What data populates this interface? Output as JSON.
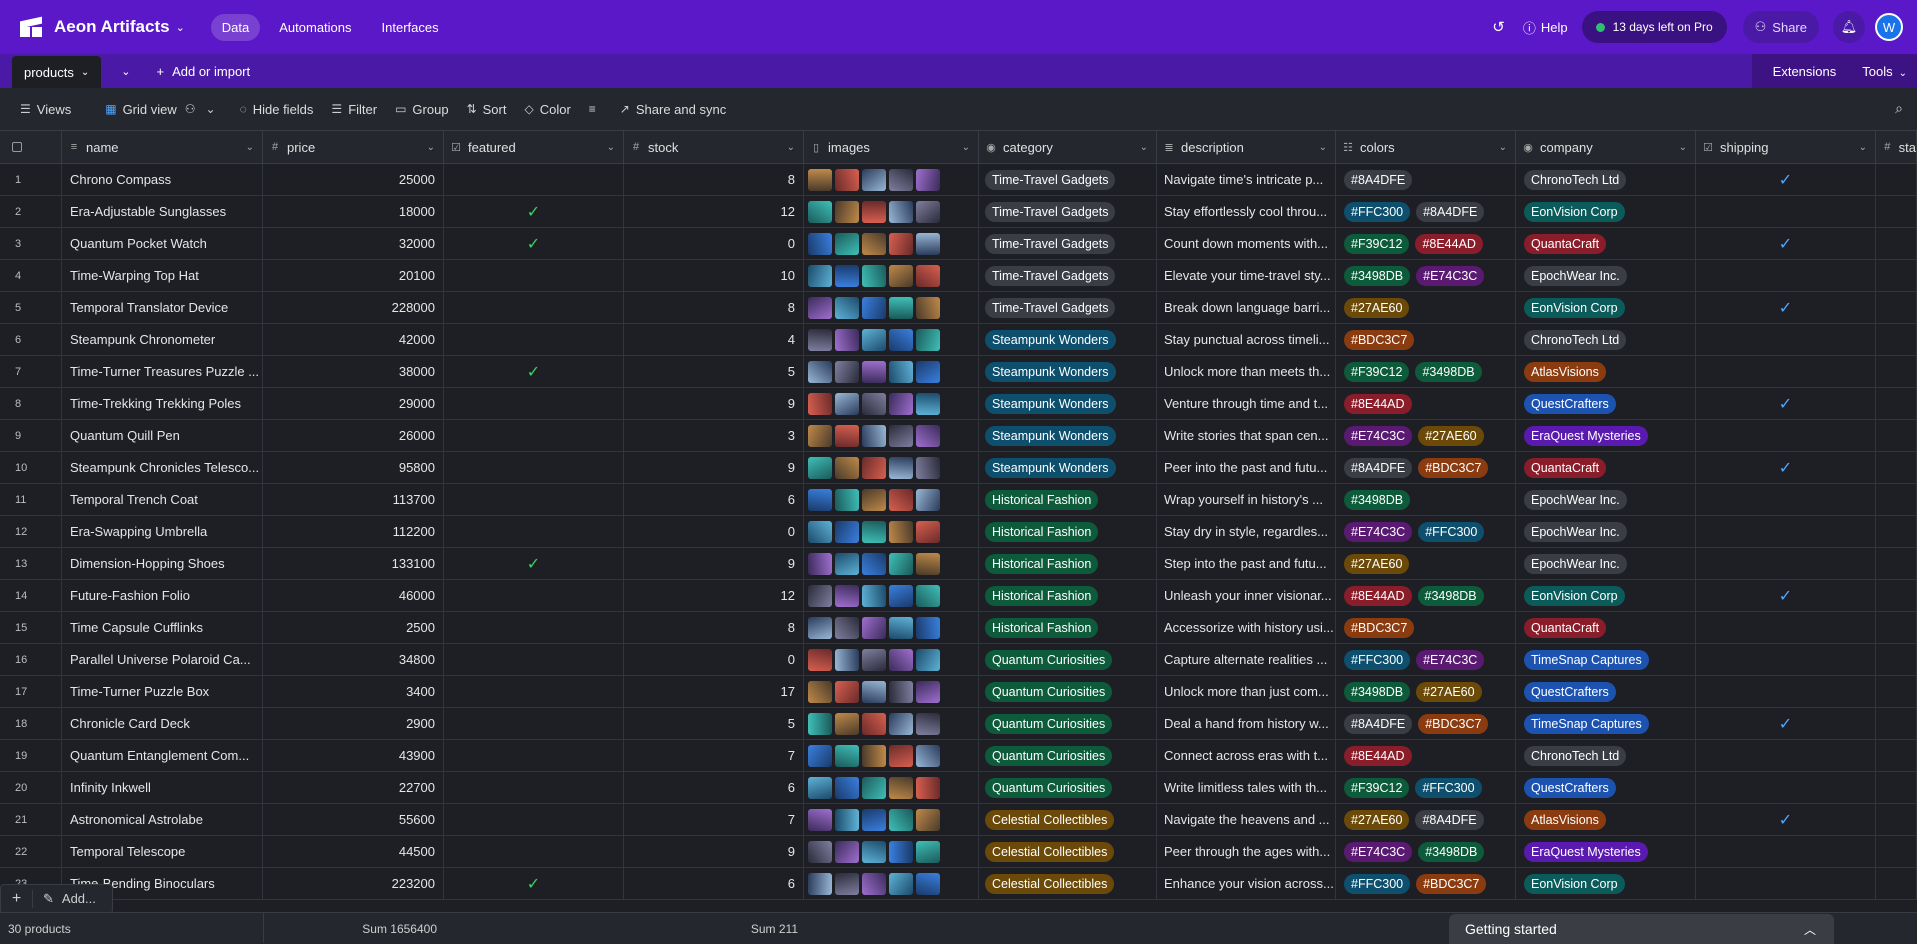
{
  "header": {
    "app_name": "Aeon Artifacts",
    "nav": [
      {
        "label": "Data",
        "active": true
      },
      {
        "label": "Automations"
      },
      {
        "label": "Interfaces"
      }
    ],
    "help": "Help",
    "trial": "13 days left on Pro",
    "share": "Share",
    "avatar": "W"
  },
  "tabbar": {
    "table": "products",
    "add": "Add or import",
    "extensions": "Extensions",
    "tools": "Tools"
  },
  "toolbar": {
    "views": "Views",
    "grid_view": "Grid view",
    "hide_fields": "Hide fields",
    "filter": "Filter",
    "group": "Group",
    "sort": "Sort",
    "color": "Color",
    "share_sync": "Share and sync"
  },
  "columns": [
    {
      "label": "name",
      "icon": "text-icon"
    },
    {
      "label": "price",
      "icon": "number-icon"
    },
    {
      "label": "featured",
      "icon": "checkbox-icon"
    },
    {
      "label": "stock",
      "icon": "number-icon"
    },
    {
      "label": "images",
      "icon": "attachment-icon"
    },
    {
      "label": "category",
      "icon": "select-icon"
    },
    {
      "label": "description",
      "icon": "longtext-icon"
    },
    {
      "label": "colors",
      "icon": "multiselect-icon"
    },
    {
      "label": "company",
      "icon": "select-icon"
    },
    {
      "label": "shipping",
      "icon": "checkbox-icon"
    },
    {
      "label": "sta",
      "icon": "number-icon"
    }
  ],
  "colors": {
    "Time-Travel Gadgets": "#3b3d44",
    "Steampunk Wonders": "#0e4f6e",
    "Historical Fashion": "#0d5b3b",
    "Quantum Curiosities": "#0d5b3b",
    "Celestial Collectibles": "#6b4a09",
    "ChronoTech Ltd": "#3b3d44",
    "EonVision Corp": "#0b5b5b",
    "QuantaCraft": "#8a1d2a",
    "EpochWear Inc.": "#3b3d44",
    "AtlasVisions": "#8a3b0f",
    "QuestCrafters": "#1c52b0",
    "EraQuest Mysteries": "#5a1ab0",
    "TimeSnap Captures": "#1c52b0",
    "#8A4DFE": "#3b3d44",
    "#FFC300": "#0e4f6e",
    "#F39C12": "#0d5b3b",
    "#8E44AD": "#8a1d2a",
    "#3498DB": "#0d5b3b",
    "#E74C3C": "#5a1a72",
    "#27AE60": "#6b4a09",
    "#BDC3C7": "#8a3b0f"
  },
  "rows": [
    {
      "n": "1",
      "name": "Chrono Compass",
      "price": "25000",
      "featured": false,
      "stock": "8",
      "category": "Time-Travel Gadgets",
      "description": "Navigate time's intricate p...",
      "colors": [
        "#8A4DFE"
      ],
      "company": "ChronoTech Ltd",
      "shipping": true
    },
    {
      "n": "2",
      "name": "Era-Adjustable Sunglasses",
      "price": "18000",
      "featured": true,
      "stock": "12",
      "category": "Time-Travel Gadgets",
      "description": "Stay effortlessly cool throu...",
      "colors": [
        "#FFC300",
        "#8A4DFE"
      ],
      "company": "EonVision Corp",
      "shipping": false
    },
    {
      "n": "3",
      "name": "Quantum Pocket Watch",
      "price": "32000",
      "featured": true,
      "stock": "0",
      "category": "Time-Travel Gadgets",
      "description": "Count down moments with...",
      "colors": [
        "#F39C12",
        "#8E44AD"
      ],
      "company": "QuantaCraft",
      "shipping": true
    },
    {
      "n": "4",
      "name": "Time-Warping Top Hat",
      "price": "20100",
      "featured": false,
      "stock": "10",
      "category": "Time-Travel Gadgets",
      "description": "Elevate your time-travel sty...",
      "colors": [
        "#3498DB",
        "#E74C3C"
      ],
      "company": "EpochWear Inc.",
      "shipping": false
    },
    {
      "n": "5",
      "name": "Temporal Translator Device",
      "price": "228000",
      "featured": false,
      "stock": "8",
      "category": "Time-Travel Gadgets",
      "description": "Break down language barri...",
      "colors": [
        "#27AE60"
      ],
      "company": "EonVision Corp",
      "shipping": true
    },
    {
      "n": "6",
      "name": "Steampunk Chronometer",
      "price": "42000",
      "featured": false,
      "stock": "4",
      "category": "Steampunk Wonders",
      "description": "Stay punctual across timeli...",
      "colors": [
        "#BDC3C7"
      ],
      "company": "ChronoTech Ltd",
      "shipping": false
    },
    {
      "n": "7",
      "name": "Time-Turner Treasures Puzzle ...",
      "price": "38000",
      "featured": true,
      "stock": "5",
      "category": "Steampunk Wonders",
      "description": "Unlock more than meets th...",
      "colors": [
        "#F39C12",
        "#3498DB"
      ],
      "company": "AtlasVisions",
      "shipping": false
    },
    {
      "n": "8",
      "name": "Time-Trekking Trekking Poles",
      "price": "29000",
      "featured": false,
      "stock": "9",
      "category": "Steampunk Wonders",
      "description": "Venture through time and t...",
      "colors": [
        "#8E44AD"
      ],
      "company": "QuestCrafters",
      "shipping": true
    },
    {
      "n": "9",
      "name": "Quantum Quill Pen",
      "price": "26000",
      "featured": false,
      "stock": "3",
      "category": "Steampunk Wonders",
      "description": "Write stories that span cen...",
      "colors": [
        "#E74C3C",
        "#27AE60"
      ],
      "company": "EraQuest Mysteries",
      "shipping": false
    },
    {
      "n": "10",
      "name": "Steampunk Chronicles Telesco...",
      "price": "95800",
      "featured": false,
      "stock": "9",
      "category": "Steampunk Wonders",
      "description": "Peer into the past and futu...",
      "colors": [
        "#8A4DFE",
        "#BDC3C7"
      ],
      "company": "QuantaCraft",
      "shipping": true
    },
    {
      "n": "11",
      "name": "Temporal Trench Coat",
      "price": "113700",
      "featured": false,
      "stock": "6",
      "category": "Historical Fashion",
      "description": "Wrap yourself in history's ...",
      "colors": [
        "#3498DB"
      ],
      "company": "EpochWear Inc.",
      "shipping": false
    },
    {
      "n": "12",
      "name": "Era-Swapping Umbrella",
      "price": "112200",
      "featured": false,
      "stock": "0",
      "category": "Historical Fashion",
      "description": "Stay dry in style, regardles...",
      "colors": [
        "#E74C3C",
        "#FFC300"
      ],
      "company": "EpochWear Inc.",
      "shipping": false
    },
    {
      "n": "13",
      "name": "Dimension-Hopping Shoes",
      "price": "133100",
      "featured": true,
      "stock": "9",
      "category": "Historical Fashion",
      "description": "Step into the past and futu...",
      "colors": [
        "#27AE60"
      ],
      "company": "EpochWear Inc.",
      "shipping": false
    },
    {
      "n": "14",
      "name": "Future-Fashion Folio",
      "price": "46000",
      "featured": false,
      "stock": "12",
      "category": "Historical Fashion",
      "description": "Unleash your inner visionar...",
      "colors": [
        "#8E44AD",
        "#3498DB"
      ],
      "company": "EonVision Corp",
      "shipping": true
    },
    {
      "n": "15",
      "name": "Time Capsule Cufflinks",
      "price": "2500",
      "featured": false,
      "stock": "8",
      "category": "Historical Fashion",
      "description": "Accessorize with history usi...",
      "colors": [
        "#BDC3C7"
      ],
      "company": "QuantaCraft",
      "shipping": false
    },
    {
      "n": "16",
      "name": "Parallel Universe Polaroid Ca...",
      "price": "34800",
      "featured": false,
      "stock": "0",
      "category": "Quantum Curiosities",
      "description": "Capture alternate realities ...",
      "colors": [
        "#FFC300",
        "#E74C3C"
      ],
      "company": "TimeSnap Captures",
      "shipping": false
    },
    {
      "n": "17",
      "name": "Time-Turner Puzzle Box",
      "price": "3400",
      "featured": false,
      "stock": "17",
      "category": "Quantum Curiosities",
      "description": "Unlock more than just com...",
      "colors": [
        "#3498DB",
        "#27AE60"
      ],
      "company": "QuestCrafters",
      "shipping": false
    },
    {
      "n": "18",
      "name": "Chronicle Card Deck",
      "price": "2900",
      "featured": false,
      "stock": "5",
      "category": "Quantum Curiosities",
      "description": "Deal a hand from history w...",
      "colors": [
        "#8A4DFE",
        "#BDC3C7"
      ],
      "company": "TimeSnap Captures",
      "shipping": true
    },
    {
      "n": "19",
      "name": "Quantum Entanglement Com...",
      "price": "43900",
      "featured": false,
      "stock": "7",
      "category": "Quantum Curiosities",
      "description": "Connect across eras with t...",
      "colors": [
        "#8E44AD"
      ],
      "company": "ChronoTech Ltd",
      "shipping": false
    },
    {
      "n": "20",
      "name": "Infinity Inkwell",
      "price": "22700",
      "featured": false,
      "stock": "6",
      "category": "Quantum Curiosities",
      "description": "Write limitless tales with th...",
      "colors": [
        "#F39C12",
        "#FFC300"
      ],
      "company": "QuestCrafters",
      "shipping": false
    },
    {
      "n": "21",
      "name": "Astronomical Astrolabe",
      "price": "55600",
      "featured": false,
      "stock": "7",
      "category": "Celestial Collectibles",
      "description": "Navigate the heavens and ...",
      "colors": [
        "#27AE60",
        "#8A4DFE"
      ],
      "company": "AtlasVisions",
      "shipping": true
    },
    {
      "n": "22",
      "name": "Temporal Telescope",
      "price": "44500",
      "featured": false,
      "stock": "9",
      "category": "Celestial Collectibles",
      "description": "Peer through the ages with...",
      "colors": [
        "#E74C3C",
        "#3498DB"
      ],
      "company": "EraQuest Mysteries",
      "shipping": false
    },
    {
      "n": "23",
      "name": "Time-Bending Binoculars",
      "price": "223200",
      "featured": true,
      "stock": "6",
      "category": "Celestial Collectibles",
      "description": "Enhance your vision across...",
      "colors": [
        "#FFC300",
        "#BDC3C7"
      ],
      "company": "EonVision Corp",
      "shipping": false
    }
  ],
  "footer": {
    "count": "30 products",
    "price_sum": "Sum 1656400",
    "stock_sum": "Sum 211",
    "add": "Add...",
    "getting_started": "Getting started"
  }
}
